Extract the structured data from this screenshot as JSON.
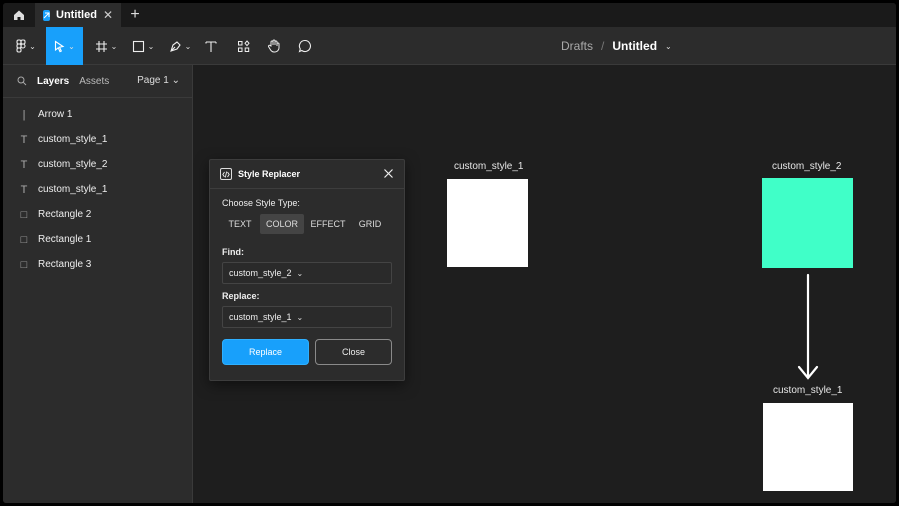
{
  "tabbar": {
    "tab_label": "Untitled",
    "close_glyph": "✕",
    "add_glyph": "+"
  },
  "toolbar": {
    "breadcrumb": "Drafts",
    "separator": "/",
    "doc_title": "Untitled",
    "caret": "⌄"
  },
  "sidebar": {
    "tabs": [
      "Layers",
      "Assets"
    ],
    "page_selector": "Page 1 ⌄",
    "layers": [
      {
        "icon": "line-icon",
        "label": "Arrow 1",
        "glyph": "|"
      },
      {
        "icon": "text-icon",
        "label": "custom_style_1",
        "glyph": "T"
      },
      {
        "icon": "text-icon",
        "label": "custom_style_2",
        "glyph": "T"
      },
      {
        "icon": "text-icon",
        "label": "custom_style_1",
        "glyph": "T"
      },
      {
        "icon": "rectangle-icon",
        "label": "Rectangle 2",
        "glyph": "□"
      },
      {
        "icon": "rectangle-icon",
        "label": "Rectangle 1",
        "glyph": "□"
      },
      {
        "icon": "rectangle-icon",
        "label": "Rectangle 3",
        "glyph": "□"
      }
    ]
  },
  "canvas": {
    "labels": [
      "custom_style_1",
      "custom_style_2",
      "custom_style_1"
    ],
    "colors": {
      "white": "#ffffff",
      "teal": "#40ffc8"
    }
  },
  "dialog": {
    "title": "Style Replacer",
    "choose_label": "Choose Style Type:",
    "types": [
      "TEXT",
      "COLOR",
      "EFFECT",
      "GRID"
    ],
    "selected_type": "COLOR",
    "find_label": "Find:",
    "find_value": "custom_style_2",
    "replace_label": "Replace:",
    "replace_value": "custom_style_1",
    "replace_button": "Replace",
    "close_button": "Close",
    "chevron": "⌄"
  },
  "theme": {
    "accent": "#18a0fb",
    "panel": "#2c2c2c",
    "canvas": "#1e1e1e"
  }
}
